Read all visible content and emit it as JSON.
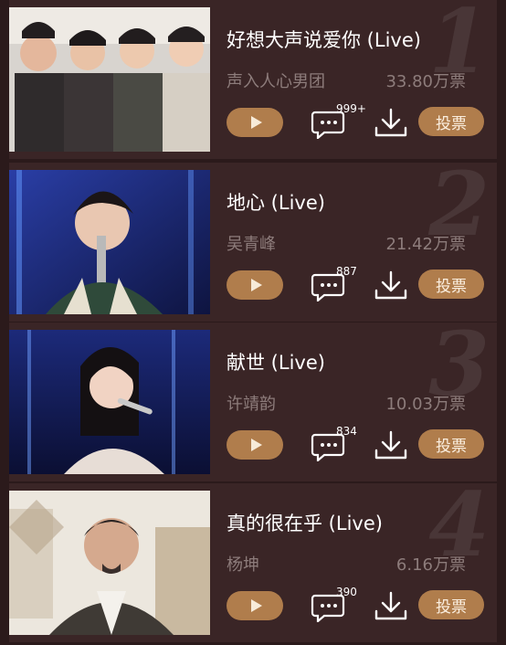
{
  "songs": [
    {
      "rank": "1",
      "title": "好想大声说爱你 (Live)",
      "artist": "声入人心男团",
      "votes": "33.80万票",
      "comments": "999+",
      "vote_label": "投票"
    },
    {
      "rank": "2",
      "title": "地心 (Live)",
      "artist": "吴青峰",
      "votes": "21.42万票",
      "comments": "887",
      "vote_label": "投票"
    },
    {
      "rank": "3",
      "title": "献世 (Live)",
      "artist": "许靖韵",
      "votes": "10.03万票",
      "comments": "834",
      "vote_label": "投票"
    },
    {
      "rank": "4",
      "title": "真的很在乎 (Live)",
      "artist": "杨坤",
      "votes": "6.16万票",
      "comments": "390",
      "vote_label": "投票"
    }
  ],
  "colors": {
    "background": "#2b1a1b",
    "card": "#3a2526",
    "accent": "#b07d4c",
    "muted_text": "#8d7c7b"
  }
}
